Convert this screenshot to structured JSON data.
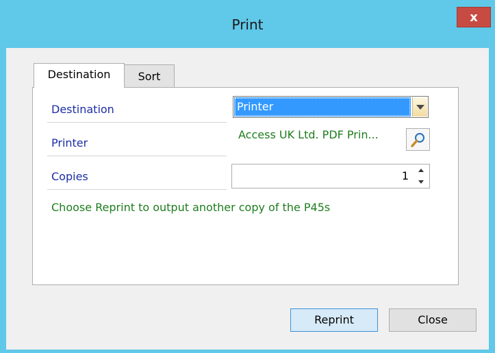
{
  "window": {
    "title": "Print",
    "close_label": "x"
  },
  "tabs": [
    {
      "label": "Destination",
      "selected": true
    },
    {
      "label": "Sort",
      "selected": false
    }
  ],
  "form": {
    "destination": {
      "label": "Destination",
      "value": "Printer"
    },
    "printer": {
      "label": "Printer",
      "value": "Access UK Ltd. PDF Prin..."
    },
    "copies": {
      "label": "Copies",
      "value": "1"
    },
    "hint": "Choose Reprint to output another copy of the P45s"
  },
  "buttons": {
    "reprint": "Reprint",
    "close": "Close"
  },
  "icons": {
    "lookup": "magnifier-icon",
    "dropdown": "chevron-down-icon",
    "spin_up": "arrow-up-icon",
    "spin_down": "arrow-down-icon"
  },
  "colors": {
    "titlebar": "#60c8e8",
    "close_button": "#c74b43",
    "label_text": "#1c2ea6",
    "value_text": "#1e7d1e",
    "selection": "#3399ff"
  }
}
